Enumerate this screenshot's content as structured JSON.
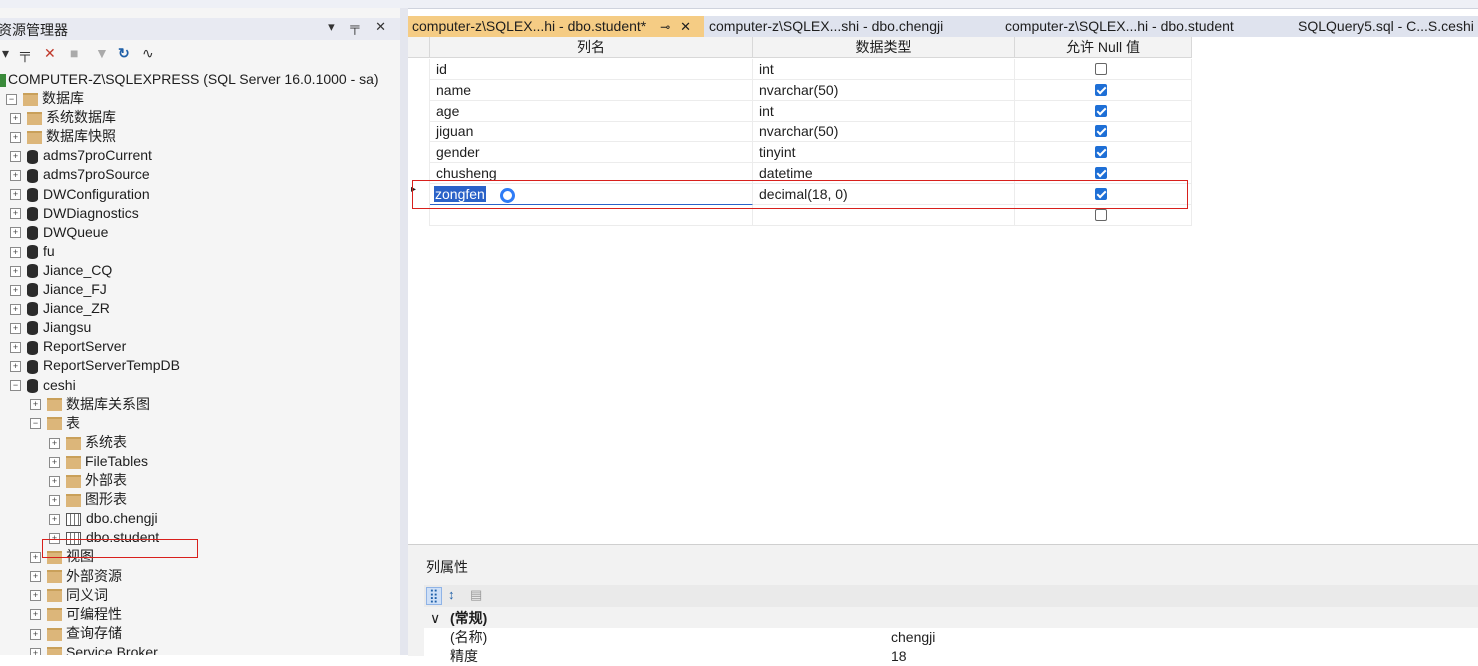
{
  "object_explorer": {
    "title": "资源管理器",
    "header_buttons": "▾ ╤ ✕",
    "toolbar": [
      "▾",
      "╤",
      "✕",
      "■",
      "▼",
      "↻",
      "∿"
    ],
    "server": "COMPUTER-Z\\SQLEXPRESS (SQL Server 16.0.1000 - sa)",
    "tree": [
      {
        "label": "数据库",
        "kind": "folder",
        "level": 0,
        "exp": "−"
      },
      {
        "label": "系统数据库",
        "kind": "folder",
        "level": 1,
        "exp": "+"
      },
      {
        "label": "数据库快照",
        "kind": "folder",
        "level": 1,
        "exp": "+"
      },
      {
        "label": "adms7proCurrent",
        "kind": "db",
        "level": 1,
        "exp": "+"
      },
      {
        "label": "adms7proSource",
        "kind": "db",
        "level": 1,
        "exp": "+"
      },
      {
        "label": "DWConfiguration",
        "kind": "db",
        "level": 1,
        "exp": "+"
      },
      {
        "label": "DWDiagnostics",
        "kind": "db",
        "level": 1,
        "exp": "+"
      },
      {
        "label": "DWQueue",
        "kind": "db",
        "level": 1,
        "exp": "+"
      },
      {
        "label": "fu",
        "kind": "db",
        "level": 1,
        "exp": "+"
      },
      {
        "label": "Jiance_CQ",
        "kind": "db",
        "level": 1,
        "exp": "+"
      },
      {
        "label": "Jiance_FJ",
        "kind": "db",
        "level": 1,
        "exp": "+"
      },
      {
        "label": "Jiance_ZR",
        "kind": "db",
        "level": 1,
        "exp": "+"
      },
      {
        "label": "Jiangsu",
        "kind": "db",
        "level": 1,
        "exp": "+"
      },
      {
        "label": "ReportServer",
        "kind": "db",
        "level": 1,
        "exp": "+"
      },
      {
        "label": "ReportServerTempDB",
        "kind": "db",
        "level": 1,
        "exp": "+"
      },
      {
        "label": "ceshi",
        "kind": "db",
        "level": 1,
        "exp": "−"
      },
      {
        "label": "数据库关系图",
        "kind": "folder",
        "level": 2,
        "exp": "+"
      },
      {
        "label": "表",
        "kind": "folder",
        "level": 2,
        "exp": "−"
      },
      {
        "label": "系统表",
        "kind": "folder",
        "level": 3,
        "exp": "+"
      },
      {
        "label": "FileTables",
        "kind": "folder",
        "level": 3,
        "exp": "+"
      },
      {
        "label": "外部表",
        "kind": "folder",
        "level": 3,
        "exp": "+"
      },
      {
        "label": "图形表",
        "kind": "folder",
        "level": 3,
        "exp": "+"
      },
      {
        "label": "dbo.chengji",
        "kind": "table",
        "level": 3,
        "exp": "+"
      },
      {
        "label": "dbo.student",
        "kind": "table",
        "level": 3,
        "exp": "+"
      },
      {
        "label": "视图",
        "kind": "folder",
        "level": 2,
        "exp": "+"
      },
      {
        "label": "外部资源",
        "kind": "folder",
        "level": 2,
        "exp": "+"
      },
      {
        "label": "同义词",
        "kind": "folder",
        "level": 2,
        "exp": "+"
      },
      {
        "label": "可编程性",
        "kind": "folder",
        "level": 2,
        "exp": "+"
      },
      {
        "label": "查询存储",
        "kind": "folder",
        "level": 2,
        "exp": "+"
      },
      {
        "label": "Service Broker",
        "kind": "folder",
        "level": 2,
        "exp": "+"
      }
    ]
  },
  "tabs": [
    {
      "label": "computer-z\\SQLEX...hi - dbo.student*",
      "pin": "⊸",
      "close": "✕"
    },
    {
      "label": "computer-z\\SQLEX...shi - dbo.chengji"
    },
    {
      "label": "computer-z\\SQLEX...hi - dbo.student"
    },
    {
      "label": "SQLQuery5.sql - C...S.ceshi ("
    }
  ],
  "designer": {
    "headers": [
      "列名",
      "数据类型",
      "允许 Null 值"
    ],
    "rows": [
      {
        "name": "id",
        "type": "int",
        "nullable": false
      },
      {
        "name": "name",
        "type": "nvarchar(50)",
        "nullable": true
      },
      {
        "name": "age",
        "type": "int",
        "nullable": true
      },
      {
        "name": "jiguan",
        "type": "nvarchar(50)",
        "nullable": true
      },
      {
        "name": "gender",
        "type": "tinyint",
        "nullable": true
      },
      {
        "name": "chusheng",
        "type": "datetime",
        "nullable": true
      },
      {
        "name": "zongfen",
        "type": "decimal(18, 0)",
        "nullable": true,
        "editing": true
      },
      {
        "name": "",
        "type": "",
        "nullable": false
      }
    ],
    "row_indicator": "▸"
  },
  "column_properties": {
    "title": "列属性",
    "tools": [
      "⣿",
      "↕",
      "▤"
    ],
    "group": "(常规)",
    "group_toggle": "∨",
    "rows": [
      {
        "key": "(名称)",
        "value": "chengji"
      },
      {
        "key": "精度",
        "value": "18"
      }
    ]
  }
}
